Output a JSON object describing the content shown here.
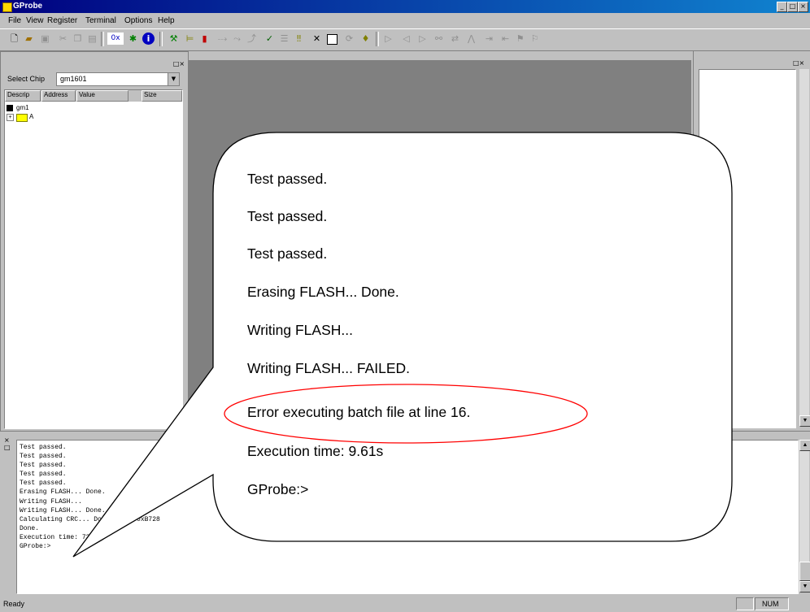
{
  "window": {
    "title": "GProbe"
  },
  "menu": [
    "File",
    "View",
    "Register",
    "Terminal",
    "Options",
    "Help"
  ],
  "left_panel": {
    "select_chip_label": "Select Chip",
    "chip_value": "gm1601",
    "columns": [
      "Descrip",
      "Address",
      "Value",
      "Size"
    ],
    "tree": [
      "gm1",
      "A"
    ]
  },
  "console_lines": [
    "Test passed.",
    "Test passed.",
    "Test passed.",
    "Test passed.",
    "Test passed.",
    "Erasing FLASH... Done.",
    "Writing FLASH...",
    "Writing FLASH... Done.",
    "Calculating CRC... Done. CRC: 0xB728",
    "Done.",
    "Execution time: 73.59s",
    "GProbe:>"
  ],
  "callout_lines": [
    "Test passed.",
    "Test passed.",
    "Test passed.",
    "Erasing FLASH... Done.",
    "Writing FLASH...",
    "Writing FLASH... FAILED.",
    "Error executing batch file at line 16.",
    "Execution time: 9.61s",
    "GProbe:>"
  ],
  "status": {
    "left": "Ready",
    "num": "NUM"
  },
  "colors": {
    "title_bar": "#000080",
    "highlight_ellipse": "#ff0000"
  }
}
